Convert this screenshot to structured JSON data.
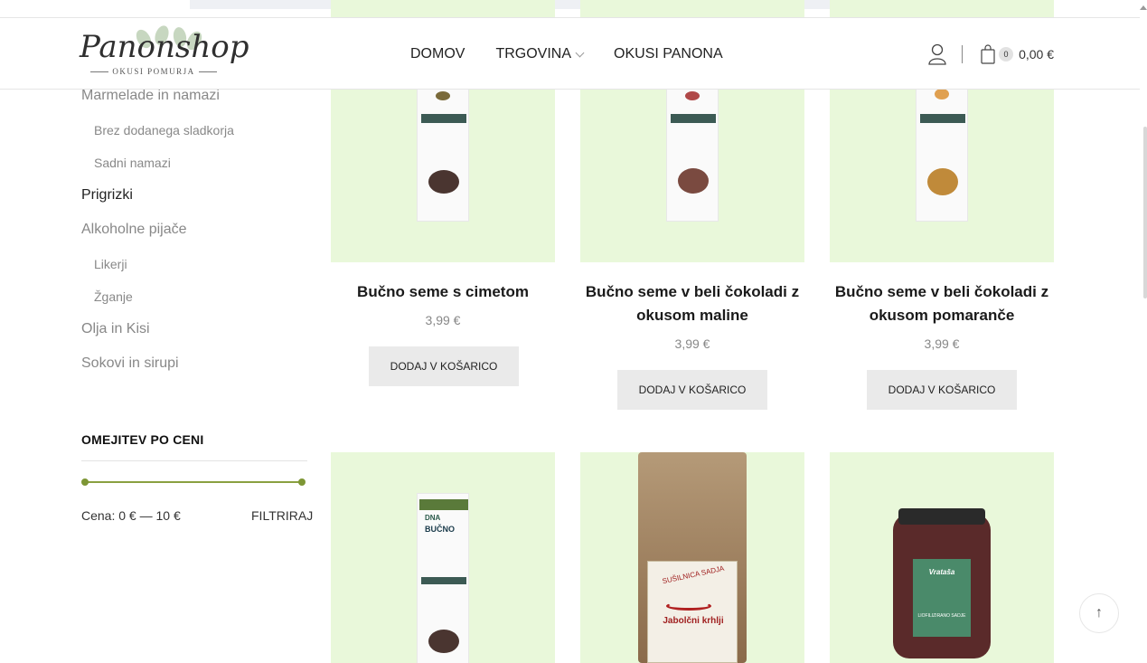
{
  "brand": {
    "logo_text": "Panonshop",
    "logo_subtitle": "OKUSI POMURJA"
  },
  "nav": {
    "items": [
      {
        "label": "DOMOV"
      },
      {
        "label": "TRGOVINA"
      },
      {
        "label": "OKUSI PANONA"
      }
    ]
  },
  "cart": {
    "count": "0",
    "total": "0,00 €"
  },
  "sidebar": {
    "categories": [
      {
        "label": "Marmelade in namazi",
        "level": 0
      },
      {
        "label": "Brez dodanega sladkorja",
        "level": 1
      },
      {
        "label": "Sadni namazi",
        "level": 1
      },
      {
        "label": "Prigrizki",
        "level": 0
      },
      {
        "label": "Alkoholne pijače",
        "level": 0
      },
      {
        "label": "Likerji",
        "level": 1
      },
      {
        "label": "Žganje",
        "level": 1
      },
      {
        "label": "Olja in Kisi",
        "level": 0
      },
      {
        "label": "Sokovi in sirupi",
        "level": 0
      }
    ],
    "price_filter": {
      "title": "OMEJITEV PO CENI",
      "label": "Cena: 0 € — 10 €",
      "button": "FILTRIRAJ",
      "min": 0,
      "max": 10
    }
  },
  "products": [
    {
      "title": "Bučno seme s cimetom",
      "price": "3,99 €",
      "button": "DODAJ V KOŠARICO"
    },
    {
      "title": "Bučno seme v beli čokoladi z okusom maline",
      "price": "3,99 €",
      "button": "DODAJ V KOŠARICO"
    },
    {
      "title": "Bučno seme v beli čokoladi z okusom pomaranče",
      "price": "3,99 €",
      "button": "DODAJ V KOŠARICO"
    }
  ],
  "product_labels": {
    "bucno_brand": "DNA",
    "bucno_name": "BUČNO",
    "krhlji_label": "Jabolčni krhlji",
    "krhlji_header": "SUŠILNICA SADJA",
    "jar_label": "Vrataša",
    "jar_sub": "LIOFILIZIRANO SADJE"
  },
  "colors": {
    "accent_green": "#8aa040",
    "product_bg": "#e9f8da",
    "button_bg": "#eaeaea"
  }
}
